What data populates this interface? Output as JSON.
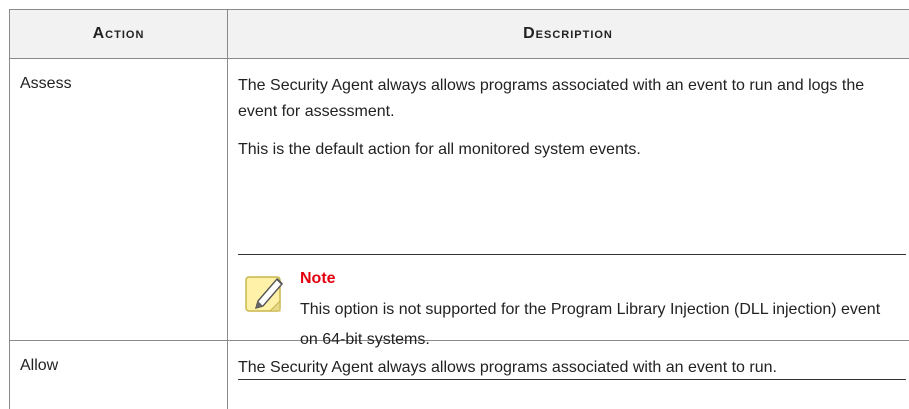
{
  "table": {
    "headers": {
      "action": "Action",
      "description": "Description"
    },
    "rows": [
      {
        "action": "Assess",
        "description": [
          "The Security Agent always allows programs associated with an event to run and logs the event for assessment.",
          "This is the default action for all monitored system events."
        ],
        "note": {
          "icon": "note-pencil-icon",
          "title": "Note",
          "text": "This option is not supported for the Program Library Injection (DLL injection) event on 64-bit systems."
        }
      },
      {
        "action": "Allow",
        "description": [
          "The Security Agent always allows programs associated with an event to run."
        ]
      }
    ]
  },
  "colors": {
    "header_bg": "#f2f2f2",
    "border": "#8a8a8a",
    "note_title": "#e3000f",
    "note_icon_fill": "#fff2a8"
  }
}
